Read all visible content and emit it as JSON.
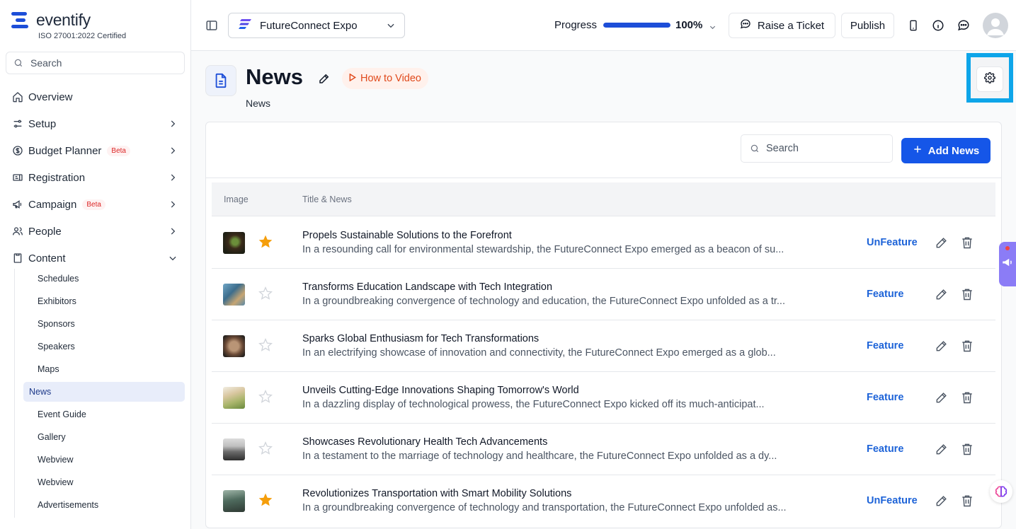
{
  "brand": {
    "name": "eventify",
    "cert": "ISO 27001:2022 Certified",
    "color": "#1d4ed8"
  },
  "sidebar": {
    "search_placeholder": "Search",
    "items": [
      {
        "label": "Overview",
        "icon": "home-icon"
      },
      {
        "label": "Setup",
        "icon": "sliders-icon"
      },
      {
        "label": "Budget Planner",
        "icon": "dollar-icon",
        "badge": "Beta"
      },
      {
        "label": "Registration",
        "icon": "registration-icon"
      },
      {
        "label": "Campaign",
        "icon": "megaphone-icon",
        "badge": "Beta"
      },
      {
        "label": "People",
        "icon": "people-icon"
      },
      {
        "label": "Content",
        "icon": "content-icon"
      }
    ],
    "content_sub": [
      "Schedules",
      "Exhibitors",
      "Sponsors",
      "Speakers",
      "Maps",
      "News",
      "Event Guide",
      "Gallery",
      "Webview",
      "Webview",
      "Advertisements"
    ],
    "active_sub": "News"
  },
  "topbar": {
    "event_name": "FutureConnect Expo",
    "progress_label": "Progress",
    "progress_value": 100,
    "progress_text": "100%",
    "raise_ticket": "Raise a Ticket",
    "publish": "Publish"
  },
  "page": {
    "title": "News",
    "subtitle": "News",
    "how_to": "How to Video"
  },
  "card": {
    "search_placeholder": "Search",
    "add_label": "Add News",
    "columns": [
      "Image",
      "Title & News"
    ]
  },
  "news": [
    {
      "title": "Propels Sustainable Solutions to the Forefront",
      "desc": "In a resounding call for environmental stewardship, the FutureConnect Expo emerged as a beacon of su...",
      "featured": true,
      "action": "UnFeature"
    },
    {
      "title": "Transforms Education Landscape with Tech Integration",
      "desc": "In a groundbreaking convergence of technology and education, the FutureConnect Expo unfolded as a tr...",
      "featured": false,
      "action": "Feature"
    },
    {
      "title": "Sparks Global Enthusiasm for Tech Transformations",
      "desc": "In an electrifying showcase of innovation and connectivity, the FutureConnect Expo emerged as a glob...",
      "featured": false,
      "action": "Feature"
    },
    {
      "title": "Unveils Cutting-Edge Innovations Shaping Tomorrow's World",
      "desc": "In a dazzling display of technological prowess, the FutureConnect Expo kicked off its much-anticipat...",
      "featured": false,
      "action": "Feature"
    },
    {
      "title": "Showcases Revolutionary Health Tech Advancements",
      "desc": "In a testament to the marriage of technology and healthcare, the FutureConnect Expo unfolded as a dy...",
      "featured": false,
      "action": "Feature"
    },
    {
      "title": "Revolutionizes Transportation with Smart Mobility Solutions",
      "desc": "In a groundbreaking convergence of technology and transportation, the FutureConnect Expo unfolded as...",
      "featured": true,
      "action": "UnFeature"
    }
  ],
  "colors": {
    "accent": "#1556e8",
    "star_on": "#f59e0b",
    "highlight": "#0ea5e9",
    "link": "#1d63d8"
  }
}
